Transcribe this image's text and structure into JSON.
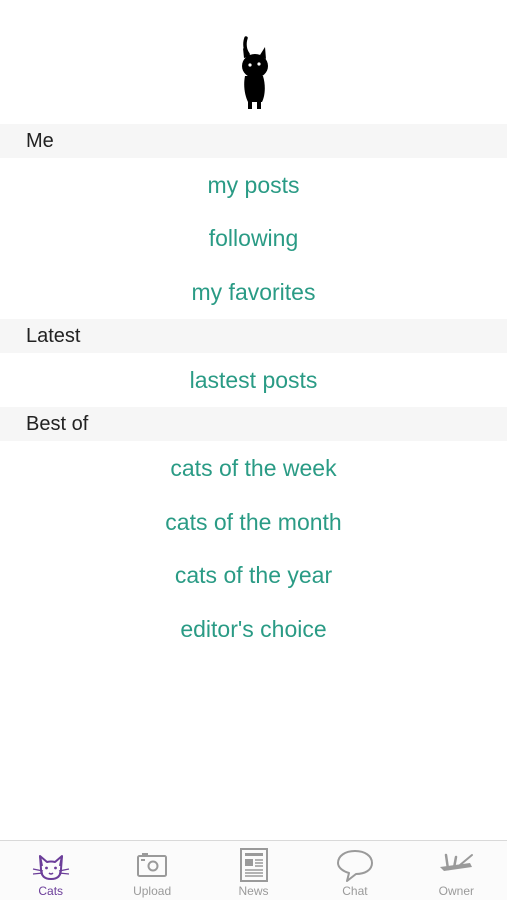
{
  "sections": {
    "me": {
      "header": "Me",
      "items": [
        "my posts",
        "following",
        "my favorites"
      ]
    },
    "latest": {
      "header": "Latest",
      "items": [
        "lastest posts"
      ]
    },
    "best_of": {
      "header": "Best of",
      "items": [
        "cats of the week",
        "cats of the month",
        "cats of the year",
        "editor's choice"
      ]
    }
  },
  "tabbar": {
    "tabs": [
      {
        "label": "Cats",
        "icon": "cat-icon",
        "active": true
      },
      {
        "label": "Upload",
        "icon": "camera-icon",
        "active": false
      },
      {
        "label": "News",
        "icon": "newspaper-icon",
        "active": false
      },
      {
        "label": "Chat",
        "icon": "speech-bubble-icon",
        "active": false
      },
      {
        "label": "Owner",
        "icon": "owner-icon",
        "active": false
      }
    ]
  },
  "colors": {
    "accent": "#2a9b85",
    "active_tab": "#6b3d99",
    "inactive_tab": "#9a9a9a",
    "section_bg": "#f6f6f6"
  }
}
